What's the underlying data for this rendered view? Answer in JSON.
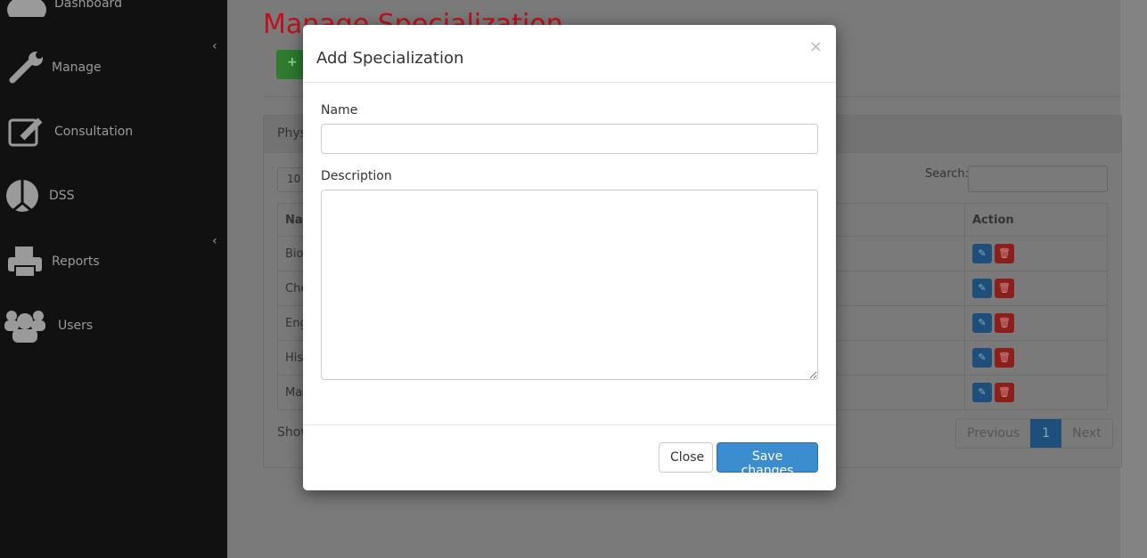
{
  "sidebar": {
    "items": [
      {
        "label": "Dashboard",
        "icon": "dashboard-icon"
      },
      {
        "label": "Manage",
        "icon": "wrench-icon"
      },
      {
        "label": "Consultation",
        "icon": "edit-icon"
      },
      {
        "label": "DSS",
        "icon": "dss-icon"
      },
      {
        "label": "Reports",
        "icon": "print-icon"
      },
      {
        "label": "Users",
        "icon": "users-icon"
      }
    ]
  },
  "page": {
    "title": "Manage Specialization",
    "add_label": "+",
    "panel_heading": "Phys",
    "length_value": "10",
    "search_label": "Search:",
    "table": {
      "headers": [
        "Na",
        "Action"
      ],
      "rows": [
        "Bio",
        "Che",
        "Eng",
        "His",
        "Ma"
      ]
    },
    "info": "Show",
    "pager": {
      "previous": "Previous",
      "current": "1",
      "next": "Next"
    }
  },
  "modal": {
    "title": "Add Specialization",
    "close_x": "×",
    "name_label": "Name",
    "name_value": "",
    "description_label": "Description",
    "description_value": "",
    "close_label": "Close",
    "save_label": "Save changes"
  },
  "colors": {
    "title": "#c0101a",
    "primary": "#3c8dd0",
    "sidebar": "#111111"
  }
}
